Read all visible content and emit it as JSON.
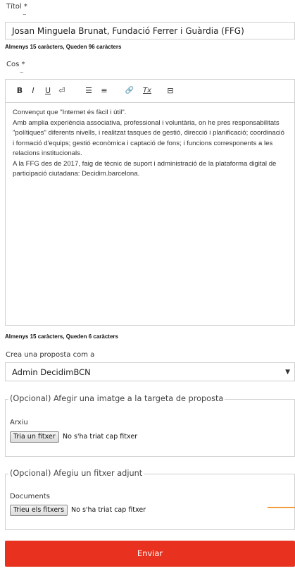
{
  "title_field": {
    "label": "Títol",
    "required_mark": "*",
    "value": "Josan Minguela Brunat, Fundació Ferrer i Guàrdia (FFG)",
    "hint": "Almenys 15 caràcters, Queden 96 caràcters"
  },
  "body_field": {
    "label": "Cos",
    "required_mark": "*",
    "toolbar": [
      "B",
      "I",
      "U",
      "⏎",
      "☰",
      "≡",
      "🔗",
      "Tx",
      "⊟"
    ],
    "content": "Convençut que \"Internet és fàcil i útil\".\nAmb amplia experiència associativa, professional i voluntària, on he pres responsabilitats \"polítiques\" diferents nivells, i realitzat tasques de gestió, direcció i planificació; coordinació i formació d'equips; gestió econòmica i captació de fons; i funcions corresponents a les relacions institucionals.\nA la FFG des de 2017, faig de tècnic de suport i administració de la plataforma digital de participació ciutadana: Decidim.barcelona.",
    "hint": "Almenys 15 caràcters, Queden 6 caràcters"
  },
  "author_field": {
    "label": "Crea una proposta com a",
    "value": "Admin DecidimBCN",
    "caret": "▼"
  },
  "image_section": {
    "legend": "(Opcional) Afegir una imatge a la targeta de proposta",
    "label": "Arxiu",
    "button": "Tria un fitxer",
    "status": "No s'ha triat cap fitxer"
  },
  "attachment_section": {
    "legend": "(Opcional) Afegiu un fitxer adjunt",
    "label": "Documents",
    "button": "Trieu els fitxers",
    "status": "No s'ha triat cap fitxer"
  },
  "submit": {
    "label": "Enviar"
  },
  "colors": {
    "accent": "#e8321f",
    "border": "#d0d0d0",
    "orange_line": "#f39a3c"
  }
}
